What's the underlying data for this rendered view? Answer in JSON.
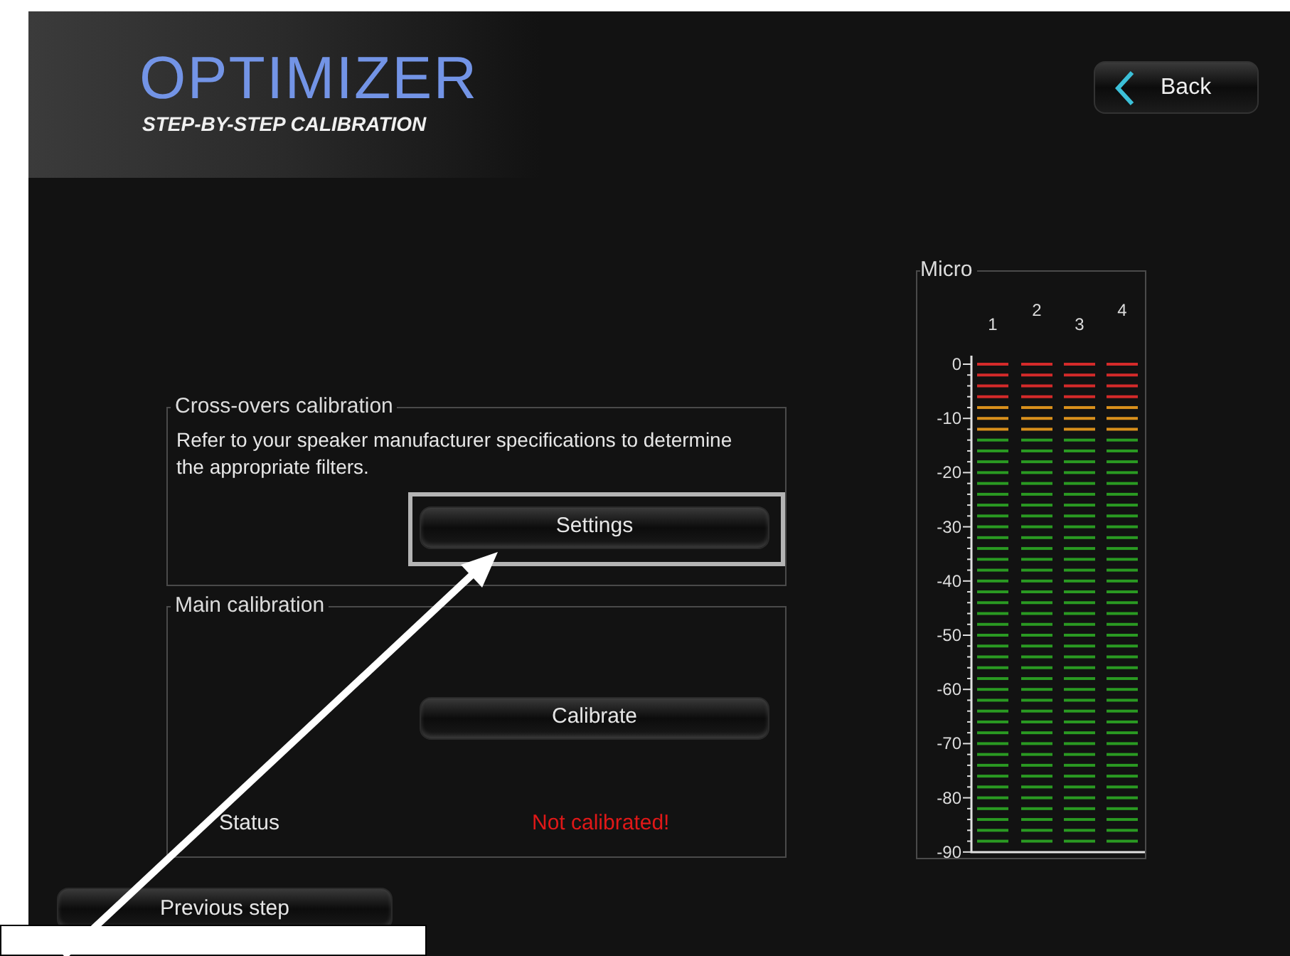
{
  "header": {
    "title": "OPTIMIZER",
    "subtitle": "STEP-BY-STEP CALIBRATION"
  },
  "back_button": "Back",
  "sections": [
    {
      "title": "Cross-overs calibration",
      "description": "Refer to your speaker manufacturer specifications to determine the appropriate filters.",
      "button": "Settings",
      "highlighted": true
    },
    {
      "title": "Main calibration",
      "button": "Calibrate",
      "status_label": "Status",
      "status_value": "Not calibrated!"
    }
  ],
  "meter": {
    "title": "Micro",
    "channels": [
      "1",
      "2",
      "3",
      "4"
    ],
    "scale": [
      "0",
      "-10",
      "-20",
      "-30",
      "-40",
      "-50",
      "-60",
      "-70",
      "-80",
      "-90"
    ]
  },
  "previous_button": "Previous step"
}
